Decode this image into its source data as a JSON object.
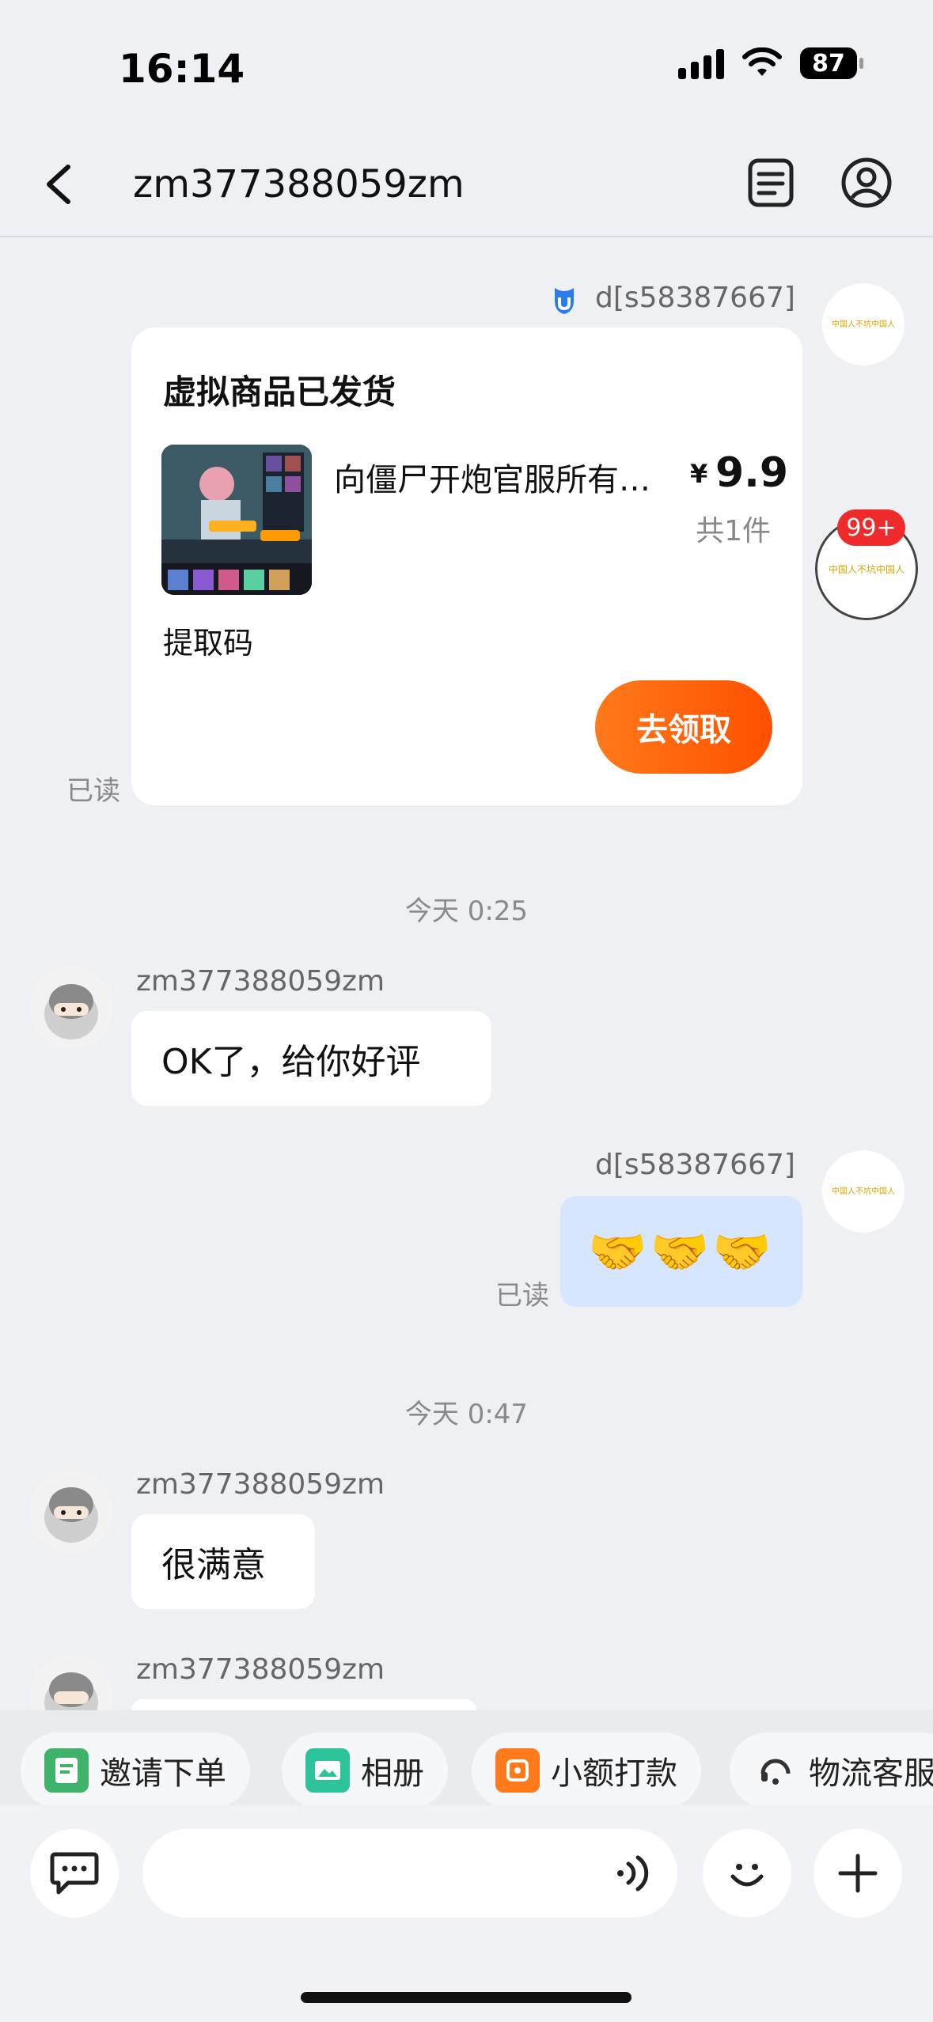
{
  "status_bar": {
    "time": "16:14",
    "battery": "87"
  },
  "nav": {
    "title": "zm377388059zm"
  },
  "own": {
    "name": "d[s58387667]",
    "avatar_text": "中国人不坑中国人"
  },
  "card": {
    "title": "虚拟商品已发货",
    "product": "向僵尸开炮官服所有兑换码",
    "currency": "¥",
    "price": "9.9",
    "quantity": "共1件",
    "code_label": "提取码",
    "claim_button": "去领取",
    "read": "已读"
  },
  "floating": {
    "badge": "99+",
    "avatar_text": "中国人不坑中国人"
  },
  "messages": {
    "divider1": "今天 0:25",
    "peer_name": "zm377388059zm",
    "msg1": "OK了，给你好评",
    "own_emoji": "🤝🤝🤝",
    "read2": "已读",
    "divider2": "今天 0:47",
    "msg2": "很满意"
  },
  "quick_actions": [
    {
      "label": "邀请下单",
      "color": "#3fb36a"
    },
    {
      "label": "相册",
      "color": "#2cc39a"
    },
    {
      "label": "小额打款",
      "color": "#ff7a1a"
    },
    {
      "label": "物流客服",
      "color": "#333333"
    }
  ]
}
